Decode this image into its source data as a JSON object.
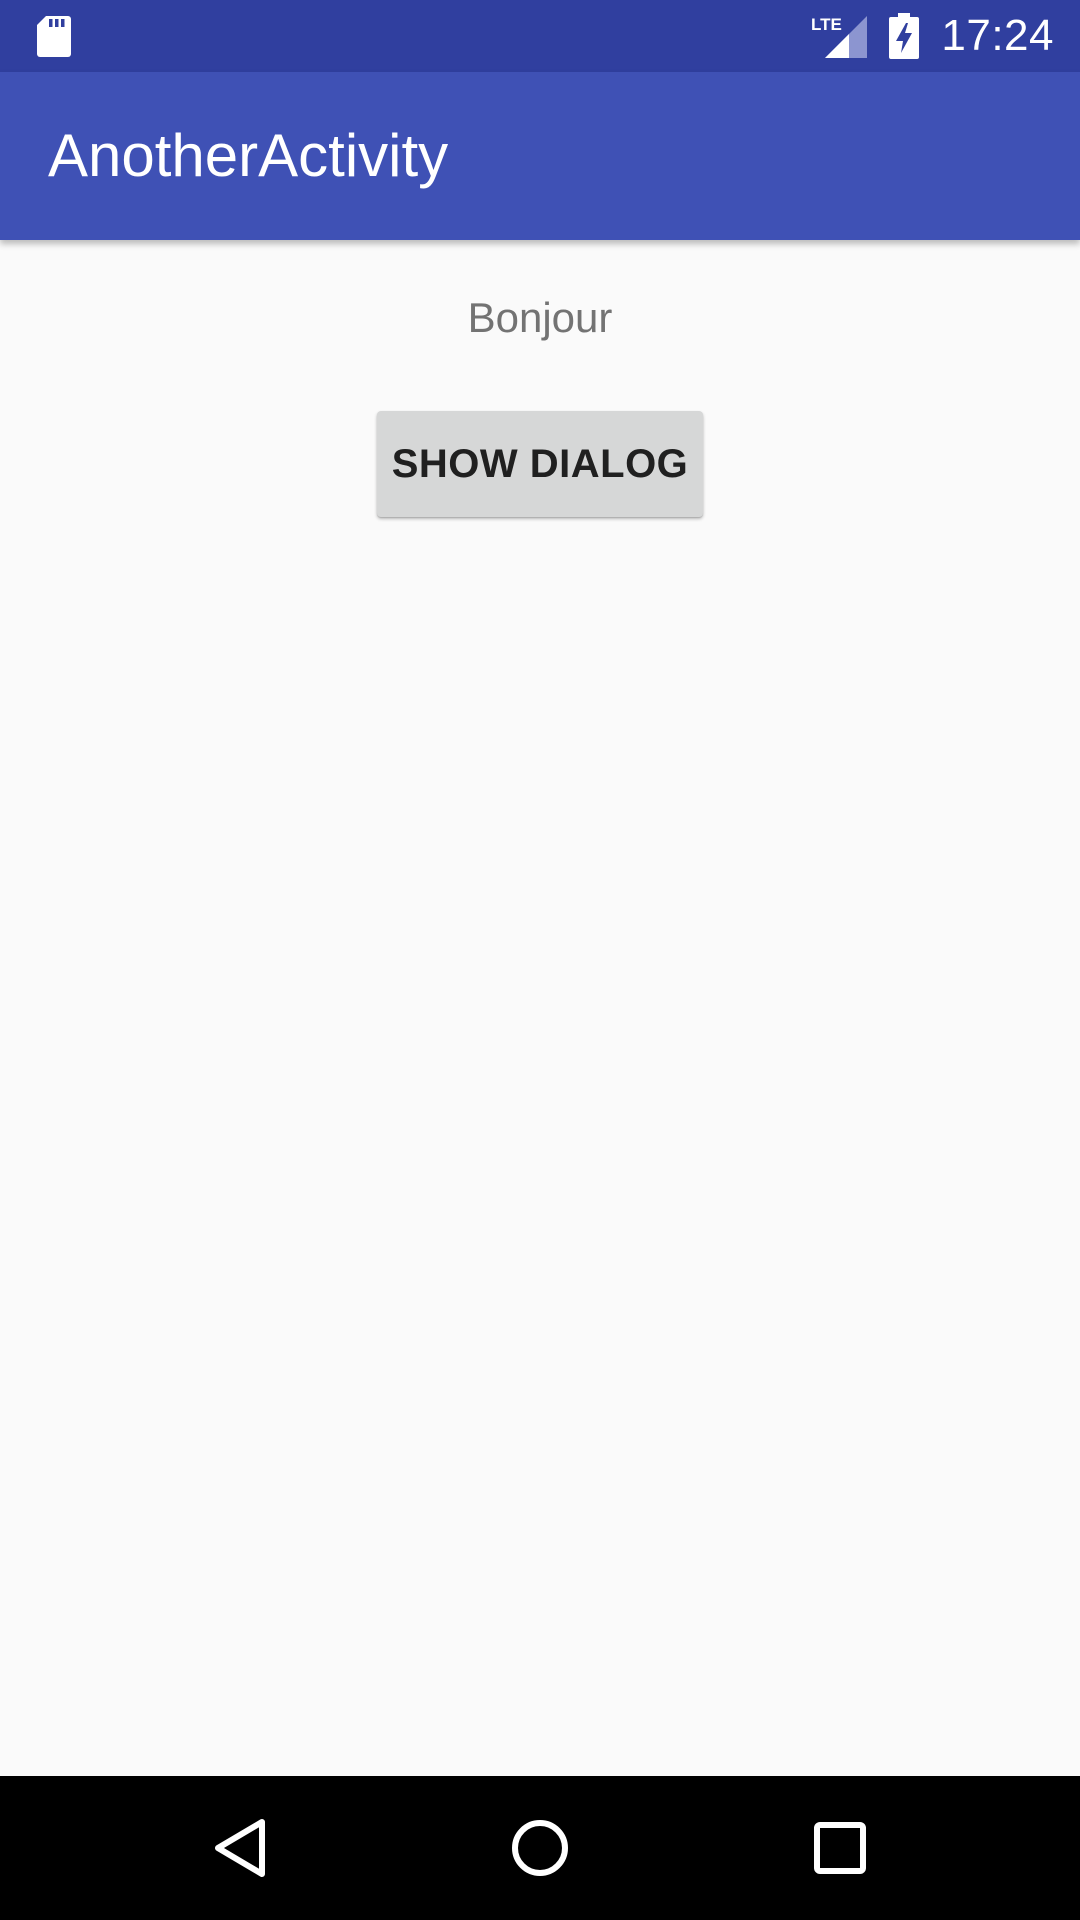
{
  "status_bar": {
    "time": "17:24",
    "network_label": "LTE",
    "icons": [
      "sd-card-icon",
      "lte-signal-icon",
      "battery-charging-icon"
    ],
    "background": "#303f9f"
  },
  "app_bar": {
    "title": "AnotherActivity",
    "background": "#3f51b5"
  },
  "content": {
    "greeting": "Bonjour",
    "show_dialog_label": "SHOW DIALOG"
  },
  "nav_bar": {
    "icons": [
      "back-icon",
      "home-icon",
      "recents-icon"
    ]
  },
  "colors": {
    "primary": "#3f51b5",
    "primary_dark": "#303f9f",
    "background": "#fafafa",
    "button": "#d6d7d7"
  }
}
